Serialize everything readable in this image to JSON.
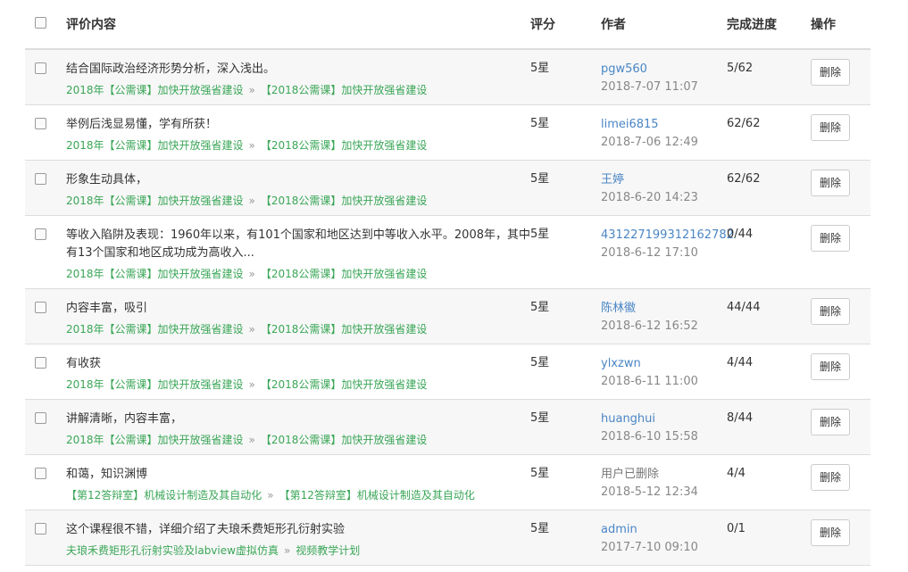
{
  "headers": {
    "content": "评价内容",
    "rating": "评分",
    "author": "作者",
    "progress": "完成进度",
    "action": "操作"
  },
  "rows": [
    {
      "comment": "结合国际政治经济形势分析，深入浅出。",
      "course": "2018年【公需课】加快开放强省建设",
      "course2": "【2018公需课】加快开放强省建设",
      "rating": "5星",
      "author": "pgw560",
      "date": "2018-7-07 11:07",
      "progress": "5/62",
      "action": "删除"
    },
    {
      "comment": "举例后浅显易懂，学有所获！",
      "course": "2018年【公需课】加快开放强省建设",
      "course2": "【2018公需课】加快开放强省建设",
      "rating": "5星",
      "author": "limei6815",
      "date": "2018-7-06 12:49",
      "progress": "62/62",
      "action": "删除"
    },
    {
      "comment": "形象生动具体，",
      "course": "2018年【公需课】加快开放强省建设",
      "course2": "【2018公需课】加快开放强省建设",
      "rating": "5星",
      "author": "王婷",
      "date": "2018-6-20 14:23",
      "progress": "62/62",
      "action": "删除"
    },
    {
      "comment": "等收入陷阱及表现：1960年以来，有101个国家和地区达到中等收入水平。2008年，其中有13个国家和地区成功成为高收入...",
      "course": "2018年【公需课】加快开放强省建设",
      "course2": "【2018公需课】加快开放强省建设",
      "rating": "5星",
      "author": "431227199312162782",
      "date": "2018-6-12 17:10",
      "progress": "0/44",
      "action": "删除"
    },
    {
      "comment": "内容丰富，吸引",
      "course": "2018年【公需课】加快开放强省建设",
      "course2": "【2018公需课】加快开放强省建设",
      "rating": "5星",
      "author": "陈林徽",
      "date": "2018-6-12 16:52",
      "progress": "44/44",
      "action": "删除"
    },
    {
      "comment": "有收获",
      "course": "2018年【公需课】加快开放强省建设",
      "course2": "【2018公需课】加快开放强省建设",
      "rating": "5星",
      "author": "ylxzwn",
      "date": "2018-6-11 11:00",
      "progress": "4/44",
      "action": "删除"
    },
    {
      "comment": "讲解清晰，内容丰富，",
      "course": "2018年【公需课】加快开放强省建设",
      "course2": "【2018公需课】加快开放强省建设",
      "rating": "5星",
      "author": "huanghui",
      "date": "2018-6-10 15:58",
      "progress": "8/44",
      "action": "删除"
    },
    {
      "comment": "和蔼，知识渊博",
      "course": "【第12答辩室】机械设计制造及其自动化",
      "course2": "【第12答辩室】机械设计制造及其自动化",
      "rating": "5星",
      "author": "用户已删除",
      "date": "2018-5-12 12:34",
      "progress": "4/4",
      "action": "删除"
    },
    {
      "comment": "这个课程很不错，详细介绍了夫琅禾费矩形孔衍射实验",
      "course": "夫琅禾费矩形孔衍射实验及labview虚拟仿真",
      "course2": "视频教学计划",
      "rating": "5星",
      "author": "admin",
      "date": "2017-7-10 09:10",
      "progress": "0/1",
      "action": "删除"
    }
  ],
  "separator": "»"
}
